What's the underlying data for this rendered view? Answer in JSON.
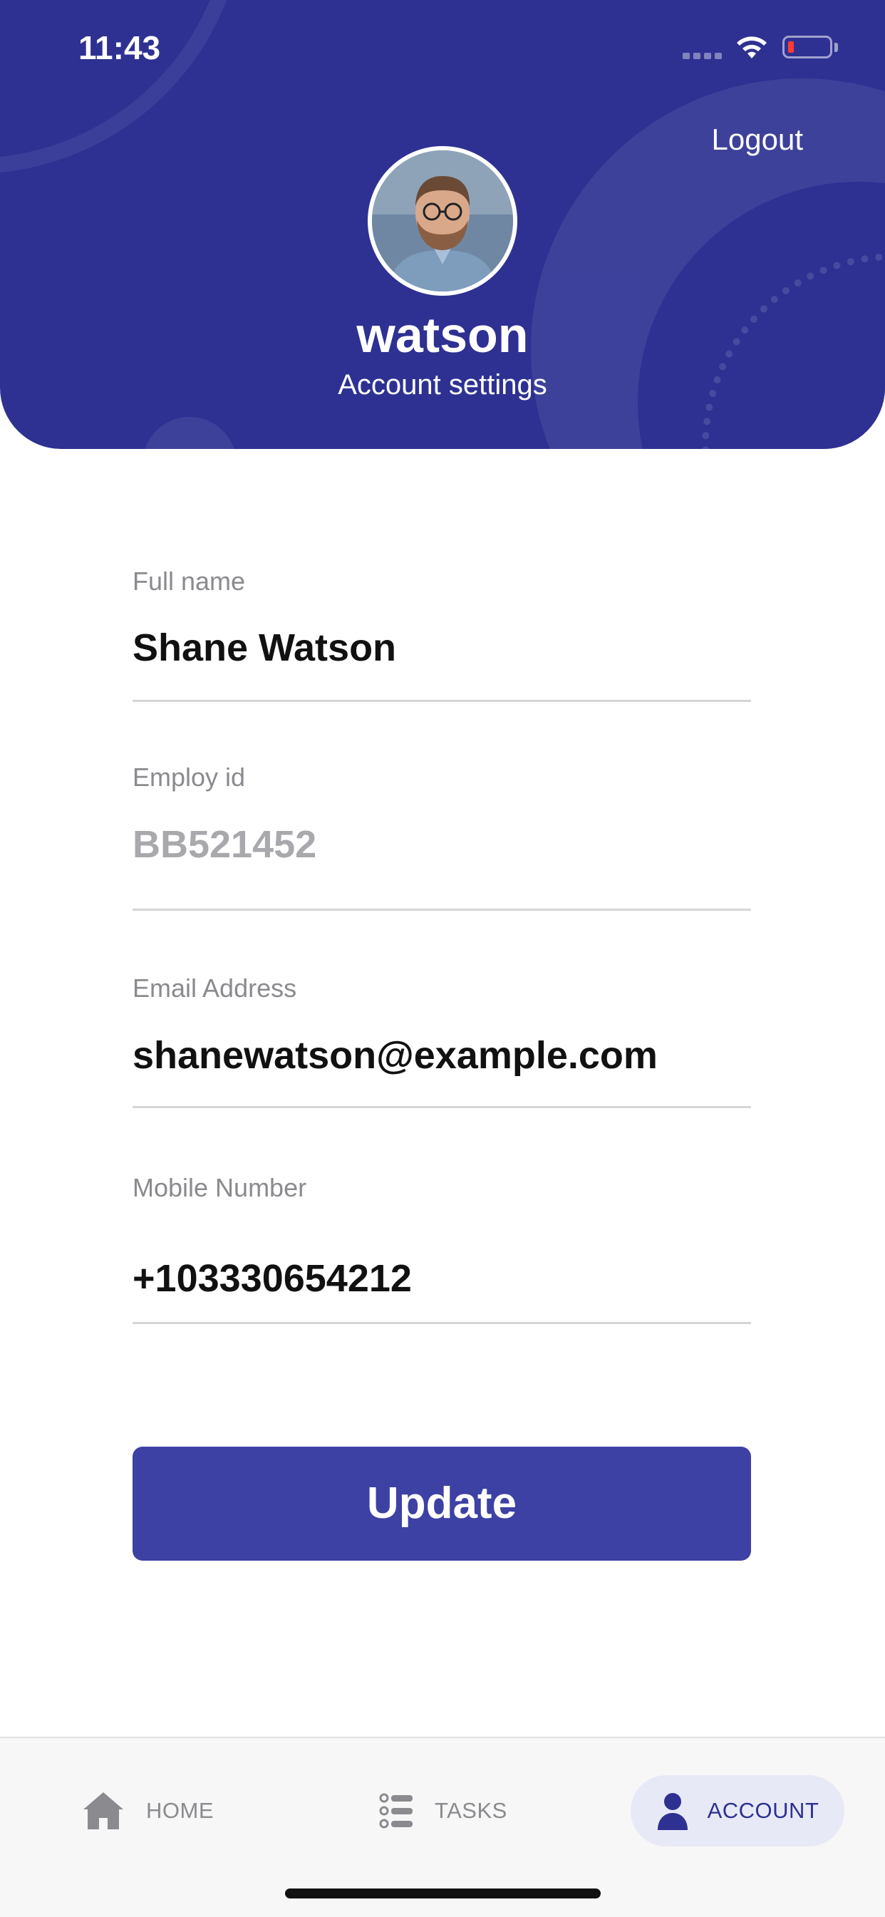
{
  "status_bar": {
    "time": "11:43"
  },
  "header": {
    "logout_label": "Logout",
    "username": "watson",
    "subtitle": "Account settings",
    "background_color": "#2e3192"
  },
  "form": {
    "fields": [
      {
        "label": "Full name",
        "value": "Shane Watson"
      },
      {
        "label": "Employ id",
        "value": "BB521452"
      },
      {
        "label": "Email Address",
        "value": "shanewatson@example.com"
      },
      {
        "label": "Mobile Number",
        "value": "+103330654212"
      }
    ],
    "update_label": "Update",
    "button_color": "#3d41a3"
  },
  "tabbar": {
    "items": [
      {
        "label": "HOME",
        "icon": "home-icon"
      },
      {
        "label": "TASKS",
        "icon": "list-icon"
      },
      {
        "label": "ACCOUNT",
        "icon": "user-icon",
        "selected": true
      }
    ]
  }
}
